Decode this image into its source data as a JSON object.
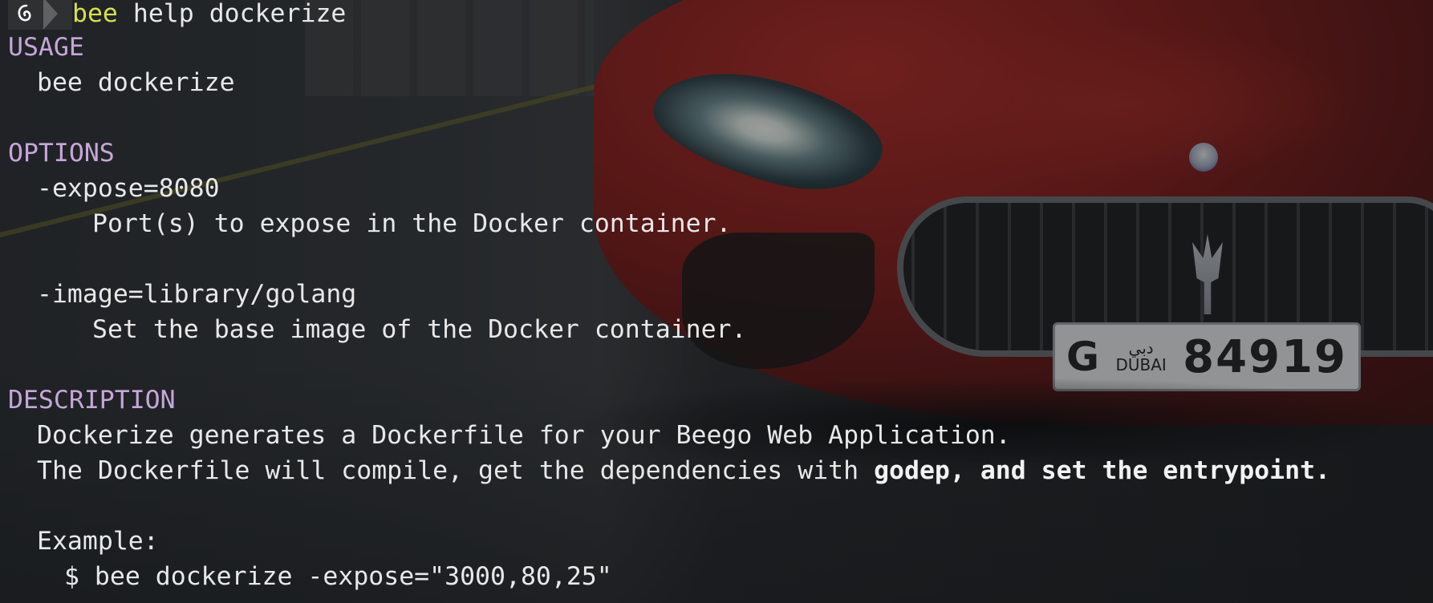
{
  "terminal": {
    "prompt": {
      "icon": "debian-swirl-icon",
      "command_name": "bee",
      "command_args": " help dockerize"
    },
    "usage": {
      "heading": "USAGE",
      "line": "bee dockerize"
    },
    "options": {
      "heading": "OPTIONS",
      "items": [
        {
          "flag": "-expose=8080",
          "desc": "Port(s) to expose in the Docker container."
        },
        {
          "flag": "-image=library/golang",
          "desc": "Set the base image of the Docker container."
        }
      ]
    },
    "description": {
      "heading": "DESCRIPTION",
      "line1": "Dockerize generates a Dockerfile for your Beego Web Application.",
      "line2_normal": "The Dockerfile will compile, get the dependencies with ",
      "line2_bold": "godep, and set the entrypoint.",
      "example_label": "Example:",
      "example_cmd": "$ bee dockerize -expose=\"3000,80,25\""
    }
  },
  "wallpaper": {
    "plate_letter": "G",
    "plate_arabic": "دبي",
    "plate_city": "DUBAI",
    "plate_number": "84919"
  },
  "colors": {
    "heading": "#c6a6d9",
    "command_highlight": "#d7e04e",
    "text": "#e8e8e8"
  }
}
